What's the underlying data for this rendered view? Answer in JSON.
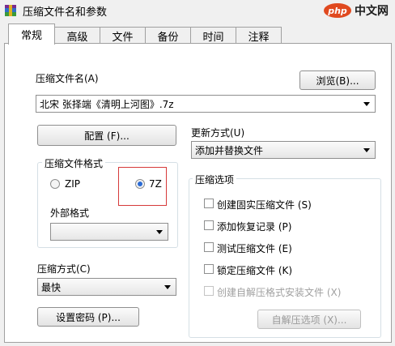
{
  "window": {
    "title": "压缩文件名和参数"
  },
  "watermark": {
    "logo": "php",
    "text": "中文网"
  },
  "tabs": [
    {
      "label": "常规",
      "active": true
    },
    {
      "label": "高级"
    },
    {
      "label": "文件"
    },
    {
      "label": "备份"
    },
    {
      "label": "时间"
    },
    {
      "label": "注释"
    }
  ],
  "archive": {
    "label": "压缩文件名(A)",
    "value": "北宋 张择端《清明上河图》.7z",
    "browse_label": "浏览(B)..."
  },
  "config_button": "配置 (F)...",
  "update_mode": {
    "label": "更新方式(U)",
    "value": "添加并替换文件"
  },
  "format": {
    "title": "压缩文件格式",
    "options": [
      {
        "label": "ZIP",
        "selected": false
      },
      {
        "label": "7Z",
        "selected": true
      }
    ],
    "external_label": "外部格式",
    "external_value": ""
  },
  "method": {
    "label": "压缩方式(C)",
    "value": "最快"
  },
  "password_button": "设置密码 (P)...",
  "options": {
    "title": "压缩选项",
    "items": [
      {
        "label": "创建固实压缩文件 (S)",
        "checked": false,
        "enabled": true
      },
      {
        "label": "添加恢复记录 (P)",
        "checked": false,
        "enabled": true
      },
      {
        "label": "测试压缩文件 (E)",
        "checked": false,
        "enabled": true
      },
      {
        "label": "锁定压缩文件 (K)",
        "checked": false,
        "enabled": true
      },
      {
        "label": "创建自解压格式安装文件 (X)",
        "checked": false,
        "enabled": false
      }
    ],
    "sfx_button": "自解压选项 (X)..."
  },
  "colors": {
    "highlight_box": "#d63a3a",
    "radio_dot": "#2a6bd4"
  }
}
